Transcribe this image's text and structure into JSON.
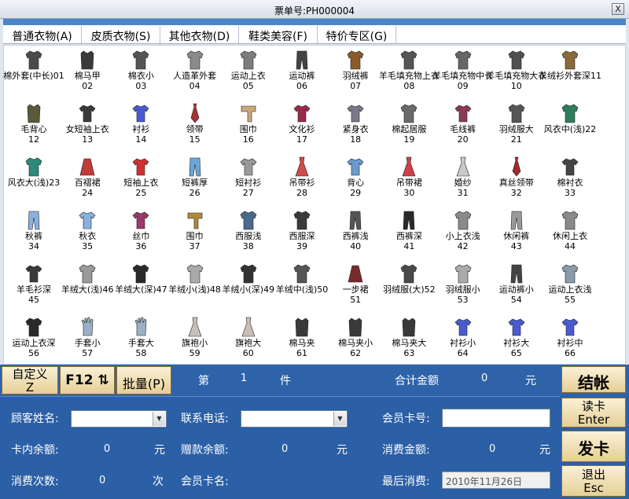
{
  "window": {
    "title": "票单号:PH000004",
    "close": "X"
  },
  "tabs": [
    {
      "label": "普通衣物(A)"
    },
    {
      "label": "皮质衣物(S)"
    },
    {
      "label": "其他衣物(D)"
    },
    {
      "label": "鞋类美容(F)"
    },
    {
      "label": "特价专区(G)"
    }
  ],
  "items": [
    {
      "label": "棉外套(中长)01",
      "color": "#4b4b4b",
      "kind": "coat"
    },
    {
      "label": "棉马甲\n02",
      "color": "#3a3a3a",
      "kind": "vest"
    },
    {
      "label": "棉衣小\n03",
      "color": "#555555",
      "kind": "coat"
    },
    {
      "label": "人造革外套\n04",
      "color": "#8a8a8a",
      "kind": "coat"
    },
    {
      "label": "运动上衣\n05",
      "color": "#7d7d7d",
      "kind": "coat"
    },
    {
      "label": "运动裤\n06",
      "color": "#444444",
      "kind": "pants"
    },
    {
      "label": "羽绒裤\n07",
      "color": "#8b5a2b",
      "kind": "coat"
    },
    {
      "label": "羊毛填充物上衣08",
      "color": "#555555",
      "kind": "coat"
    },
    {
      "label": "羊毛填充物中长09",
      "color": "#666666",
      "kind": "coat"
    },
    {
      "label": "羊毛填充物大衣10",
      "color": "#505050",
      "kind": "coat"
    },
    {
      "label": "羊绒衫外套深11",
      "color": "#8a6a3a",
      "kind": "coat"
    },
    {
      "label": "毛背心\n12",
      "color": "#5a5a3a",
      "kind": "vest"
    },
    {
      "label": "女短袖上衣\n13",
      "color": "#3a3a3a",
      "kind": "shirt"
    },
    {
      "label": "衬衫\n14",
      "color": "#4a5bd0",
      "kind": "shirt"
    },
    {
      "label": "领带\n15",
      "color": "#a83232",
      "kind": "tie"
    },
    {
      "label": "围巾\n16",
      "color": "#c9a87a",
      "kind": "scarf"
    },
    {
      "label": "文化衫\n17",
      "color": "#9a2a4a",
      "kind": "shirt"
    },
    {
      "label": "紧身衣\n18",
      "color": "#7a7a8a",
      "kind": "shirt"
    },
    {
      "label": "棉起居服\n19",
      "color": "#6a6a6a",
      "kind": "coat"
    },
    {
      "label": "毛线裤\n20",
      "color": "#8a3a5a",
      "kind": "shirt"
    },
    {
      "label": "羽绒服大\n21",
      "color": "#555555",
      "kind": "coat"
    },
    {
      "label": "风衣中(浅)22",
      "color": "#2e7d5a",
      "kind": "coat"
    },
    {
      "label": "风衣大(浅)23",
      "color": "#2e8a7a",
      "kind": "coat"
    },
    {
      "label": "百褶裙\n24",
      "color": "#c23a3a",
      "kind": "skirt"
    },
    {
      "label": "短袖上衣\n25",
      "color": "#d03030",
      "kind": "shirt"
    },
    {
      "label": "短裤厚\n26",
      "color": "#6aa7d8",
      "kind": "pants"
    },
    {
      "label": "短衬衫\n27",
      "color": "#9a9a9a",
      "kind": "shirt"
    },
    {
      "label": "吊带衫\n28",
      "color": "#d04a4a",
      "kind": "dress"
    },
    {
      "label": "背心\n29",
      "color": "#6a9ad0",
      "kind": "shirt"
    },
    {
      "label": "吊带裙\n30",
      "color": "#d0404a",
      "kind": "dress"
    },
    {
      "label": "婚纱\n31",
      "color": "#c8c8c8",
      "kind": "dress"
    },
    {
      "label": "真丝领带\n32",
      "color": "#a02a2a",
      "kind": "tie"
    },
    {
      "label": "棉衬衣\n33",
      "color": "#444444",
      "kind": "shirt"
    },
    {
      "label": "秋裤\n34",
      "color": "#8ab0e0",
      "kind": "pants"
    },
    {
      "label": "秋衣\n35",
      "color": "#8ab0e0",
      "kind": "shirt"
    },
    {
      "label": "丝巾\n36",
      "color": "#9a3a6a",
      "kind": "shirt"
    },
    {
      "label": "围巾\n37",
      "color": "#b08a3a",
      "kind": "scarf"
    },
    {
      "label": "西服浅\n38",
      "color": "#4a6a8a",
      "kind": "coat"
    },
    {
      "label": "西服深\n39",
      "color": "#3a3a3a",
      "kind": "coat"
    },
    {
      "label": "西裤浅\n40",
      "color": "#555555",
      "kind": "pants"
    },
    {
      "label": "西裤深\n41",
      "color": "#2a2a2a",
      "kind": "pants"
    },
    {
      "label": "小上衣浅\n42",
      "color": "#8a8a8a",
      "kind": "coat"
    },
    {
      "label": "休闲裤\n43",
      "color": "#9a9a9a",
      "kind": "pants"
    },
    {
      "label": "休闲上衣\n44",
      "color": "#8a8a8a",
      "kind": "coat"
    },
    {
      "label": "羊毛衫深\n45",
      "color": "#3a3a3a",
      "kind": "shirt"
    },
    {
      "label": "羊绒大(浅)46",
      "color": "#9a9a9a",
      "kind": "coat"
    },
    {
      "label": "羊绒大(深)47",
      "color": "#2a2a2a",
      "kind": "coat"
    },
    {
      "label": "羊绒小(浅)48",
      "color": "#aaaaaa",
      "kind": "coat"
    },
    {
      "label": "羊绒小(深)49",
      "color": "#333333",
      "kind": "coat"
    },
    {
      "label": "羊绒中(浅)50",
      "color": "#555555",
      "kind": "coat"
    },
    {
      "label": "一步裙\n51",
      "color": "#7a2a2a",
      "kind": "skirt"
    },
    {
      "label": "羽绒服(大)52",
      "color": "#4a4a4a",
      "kind": "coat"
    },
    {
      "label": "羽绒服小\n53",
      "color": "#aaaaaa",
      "kind": "coat"
    },
    {
      "label": "运动裤小\n54",
      "color": "#444444",
      "kind": "pants"
    },
    {
      "label": "运动上衣浅\n55",
      "color": "#8a9aaa",
      "kind": "coat"
    },
    {
      "label": "运动上衣深\n56",
      "color": "#2a2a2a",
      "kind": "coat"
    },
    {
      "label": "手套小\n57",
      "color": "#9ab0c8",
      "kind": "glove"
    },
    {
      "label": "手套大\n58",
      "color": "#9ab0c8",
      "kind": "glove"
    },
    {
      "label": "旗袍小\n59",
      "color": "#c8c0b8",
      "kind": "dress"
    },
    {
      "label": "旗袍大\n60",
      "color": "#c8c0b8",
      "kind": "dress"
    },
    {
      "label": "棉马夹\n61",
      "color": "#3a3a3a",
      "kind": "vest"
    },
    {
      "label": "棉马夹小\n62",
      "color": "#3a3a3a",
      "kind": "vest"
    },
    {
      "label": "棉马夹大\n63",
      "color": "#3a3a3a",
      "kind": "vest"
    },
    {
      "label": "衬衫小\n64",
      "color": "#4a5bd0",
      "kind": "shirt"
    },
    {
      "label": "衬衫大\n65",
      "color": "#4a5bd0",
      "kind": "shirt"
    },
    {
      "label": "衬衫中\n66",
      "color": "#4a5bd0",
      "kind": "shirt"
    }
  ],
  "toolbar": {
    "custom_label": "自定义\nZ",
    "f12_label": "F12 ⇅",
    "batch_label": "批量(P)"
  },
  "status": {
    "di": "第",
    "count": "1",
    "jian": "件",
    "total_label": "合计金额",
    "total_value": "0",
    "yuan": "元"
  },
  "checkout_label": "结帐",
  "form": {
    "customer_name_label": "顾客姓名:",
    "phone_label": "联系电话:",
    "member_card_label": "会员卡号:",
    "card_balance_label": "卡内余额:",
    "card_balance_value": "0",
    "card_balance_unit": "元",
    "gift_balance_label": "赠款余额:",
    "gift_balance_value": "0",
    "gift_balance_unit": "元",
    "spend_amount_label": "消费金额:",
    "spend_amount_value": "0",
    "spend_amount_unit": "元",
    "spend_count_label": "消费次数:",
    "spend_count_value": "0",
    "spend_count_unit": "次",
    "member_name_label": "会员卡名:",
    "last_spend_label": "最后消费:",
    "last_spend_value": "2010年11月26日"
  },
  "right_buttons": {
    "read_card": "读卡\nEnter",
    "issue_card": "发卡",
    "exit": "退出\nEsc"
  }
}
